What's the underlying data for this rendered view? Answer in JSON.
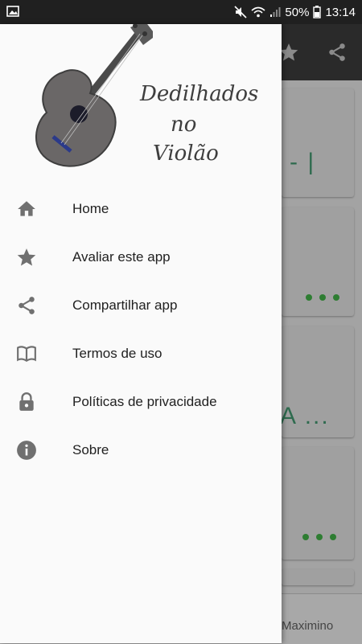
{
  "status_bar": {
    "battery": "50%",
    "time": "13:14"
  },
  "logo": {
    "line1": "Dedilhados",
    "line2": "no",
    "line3": "Violão"
  },
  "menu": [
    {
      "label": "Home",
      "icon": "home-icon"
    },
    {
      "label": "Avaliar este app",
      "icon": "star-icon"
    },
    {
      "label": "Compartilhar app",
      "icon": "share-icon"
    },
    {
      "label": "Termos de uso",
      "icon": "book-icon"
    },
    {
      "label": "Políticas de privacidade",
      "icon": "lock-icon"
    },
    {
      "label": "Sobre",
      "icon": "info-icon"
    }
  ],
  "background": {
    "card1_text": "- |",
    "card3_text": "A ...",
    "bottom_text": "Maximino"
  },
  "colors": {
    "drawer_bg": "#fafafa",
    "icon_gray": "#707070",
    "accent_green": "#2e7d32"
  }
}
